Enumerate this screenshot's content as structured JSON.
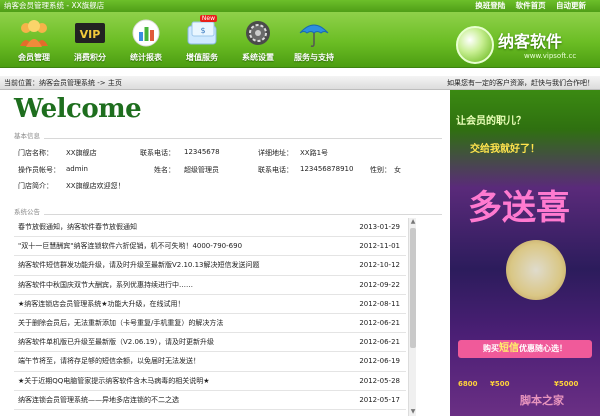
{
  "window": {
    "title": "纳客会员管理系统 - XX旗舰店"
  },
  "titlebar_links": [
    "换班登陆",
    "软件首页",
    "自动更新"
  ],
  "toolbar": [
    {
      "label": "会员管理",
      "icon": "members-icon"
    },
    {
      "label": "消费积分",
      "icon": "vip-card-icon"
    },
    {
      "label": "统计报表",
      "icon": "chart-icon"
    },
    {
      "label": "增值服务",
      "icon": "value-service-icon",
      "badge": "New"
    },
    {
      "label": "系统设置",
      "icon": "settings-icon"
    },
    {
      "label": "服务与支持",
      "icon": "umbrella-icon"
    }
  ],
  "logo": {
    "name": "纳客软件",
    "url": "www.vipsoft.cc"
  },
  "breadcrumb": {
    "text": "当前位置：纳客会员管理系统 -> 主页",
    "hint": "如果您有一定的客户资源，赶快与我们合作吧！"
  },
  "welcome": "Welcome",
  "basic_info": {
    "title": "基本信息",
    "store_name_label": "门店名称：",
    "store_name": "XX旗舰店",
    "contact_phone_label": "联系电话：",
    "contact_phone": "12345678",
    "address_label": "详细地址：",
    "address": "XX路1号",
    "operator_label": "操作员帐号：",
    "operator": "admin",
    "name_label": "姓名：",
    "name": "超级管理员",
    "phone2_label": "联系电话：",
    "phone2": "123456878910",
    "gender_label": "性别：",
    "gender": "女",
    "intro_label": "门店简介：",
    "intro": "XX旗舰店欢迎您！"
  },
  "notices": {
    "title": "系统公告",
    "rows": [
      {
        "text": "春节放假通知，纳客软件春节放假通知",
        "date": "2013-01-29"
      },
      {
        "text": "\"双十一巨慧酬宾\"纳客连锁软件六折促销，机不可失哟！4000-790-690",
        "date": "2012-11-01"
      },
      {
        "text": "纳客软件短信群发功能升级，请及时升级至最新版V2.10.13解决短信发送问题",
        "date": "2012-10-12"
      },
      {
        "text": "纳客软件中秋国庆双节大酬宾，系列优惠持续进行中……",
        "date": "2012-09-22"
      },
      {
        "text": "★纳客连锁店会员管理系统★功能大升级，在线试用！",
        "date": "2012-08-11"
      },
      {
        "text": "关于删除会员后，无法重新添加（卡号重复/手机重复）的解决方法",
        "date": "2012-06-21"
      },
      {
        "text": "纳客软件单机版已升级至最新版（V2.06.19），请及时更新升级",
        "date": "2012-06-21"
      },
      {
        "text": "端午节将至，请将存足够的短信余额，以免届时无法发送！",
        "date": "2012-06-19"
      },
      {
        "text": "★关于近期QQ电脑管家提示纳客软件含木马病毒的相关说明★",
        "date": "2012-05-28"
      },
      {
        "text": "纳客连锁会员管理系统——异地多店连锁的不二之选",
        "date": "2012-05-17"
      }
    ]
  },
  "promo": {
    "line1": "让会员的职儿？",
    "line2": "交给我就好了！",
    "big": "多送喜",
    "tag_prefix": "购买",
    "tag_highlight": "短信",
    "tag_suffix": "优惠随心选！",
    "price_left": "6800",
    "price_mid": "¥500",
    "price_right": "¥5000",
    "watermark": "脚本之家"
  },
  "colors": {
    "brand_green": "#6bbd24",
    "welcome_green": "#1e6e1e"
  }
}
